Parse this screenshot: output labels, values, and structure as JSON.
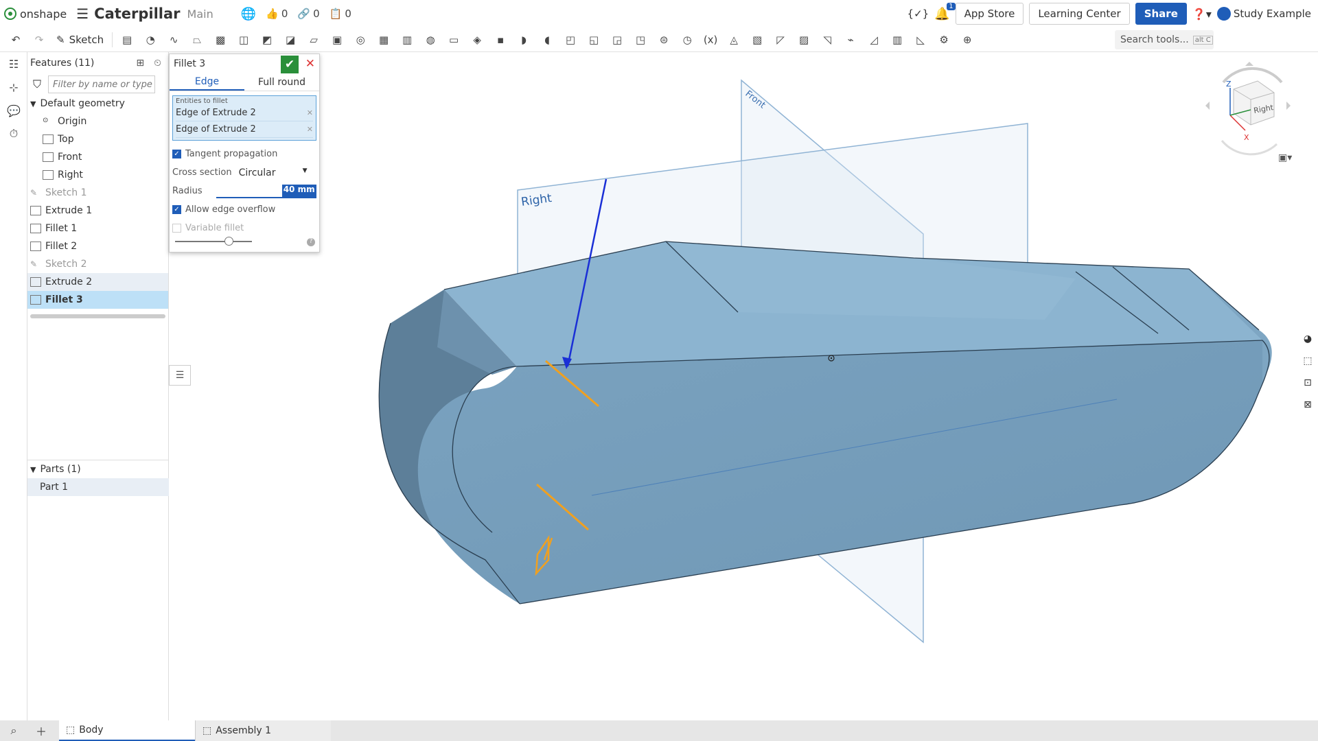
{
  "app": {
    "logo": "onshape",
    "doc_title": "Caterpillar",
    "branch": "Main",
    "likes": "0",
    "links": "0",
    "copies": "0"
  },
  "topright": {
    "notifications": "1",
    "app_store": "App Store",
    "learning_center": "Learning Center",
    "share": "Share",
    "user": "Study Example"
  },
  "toolbar": {
    "sketch_label": "Sketch",
    "search_tools": "Search tools...",
    "search_shortcut": "alt C",
    "icons": [
      "extrude-icon",
      "revolve-icon",
      "sweep-icon",
      "loft-icon",
      "thicken-icon",
      "fillet-icon",
      "chamfer-icon",
      "draft-icon",
      "rib-icon",
      "shell-icon",
      "hole-icon",
      "linear-pattern-icon",
      "mirror-icon",
      "boolean-icon",
      "split-icon",
      "transform-icon",
      "delete-part-icon",
      "modify-fillet-icon",
      "delete-face-icon",
      "move-face-icon",
      "replace-face-icon",
      "offset-surface-icon",
      "plane-icon",
      "mate-connector-icon",
      "helix-icon",
      "variable-icon",
      "configuration-icon",
      "sheet-metal-icon",
      "flange-icon",
      "tab-icon",
      "form-icon",
      "bend-icon",
      "corner-icon",
      "frame-icon",
      "gusset-icon",
      "settings-icon",
      "new-feature-icon"
    ]
  },
  "features": {
    "header": "Features (11)",
    "filter_placeholder": "Filter by name or type",
    "default_geometry": "Default geometry",
    "items": [
      {
        "label": "Origin",
        "type": "origin",
        "indent": true
      },
      {
        "label": "Top",
        "type": "plane",
        "indent": true
      },
      {
        "label": "Front",
        "type": "plane",
        "indent": true
      },
      {
        "label": "Right",
        "type": "plane",
        "indent": true
      },
      {
        "label": "Sketch 1",
        "type": "sketch",
        "state": "dim"
      },
      {
        "label": "Extrude 1",
        "type": "extrude"
      },
      {
        "label": "Fillet 1",
        "type": "fillet"
      },
      {
        "label": "Fillet 2",
        "type": "fillet"
      },
      {
        "label": "Sketch 2",
        "type": "sketch",
        "state": "dim"
      },
      {
        "label": "Extrude 2",
        "type": "extrude",
        "state": "grey"
      },
      {
        "label": "Fillet 3",
        "type": "fillet",
        "state": "selected"
      }
    ],
    "parts_header": "Parts (1)",
    "parts": [
      "Part 1"
    ]
  },
  "dialog": {
    "title": "Fillet 3",
    "tab_edge": "Edge",
    "tab_full_round": "Full round",
    "entities_label": "Entities to fillet",
    "entities": [
      "Edge of Extrude 2",
      "Edge of Extrude 2"
    ],
    "tangent_propagation": "Tangent propagation",
    "tangent_checked": true,
    "cross_section_label": "Cross section",
    "cross_section_value": "Circular",
    "radius_label": "Radius",
    "radius_value": "40 mm",
    "allow_edge_overflow": "Allow edge overflow",
    "overflow_checked": true,
    "variable_fillet": "Variable fillet",
    "variable_checked": false
  },
  "viewcube": {
    "face_right": "Right",
    "axis_z": "Z",
    "axis_x": "X"
  },
  "viewport": {
    "plane_front": "Front",
    "plane_right": "Right"
  },
  "bottom_tabs": {
    "body": "Body",
    "assembly": "Assembly 1"
  },
  "colors": {
    "accent": "#1f5db8",
    "ok_green": "#2a8f3a",
    "part_blue": "#7ba3c0",
    "selection_orange": "#f0a020"
  }
}
